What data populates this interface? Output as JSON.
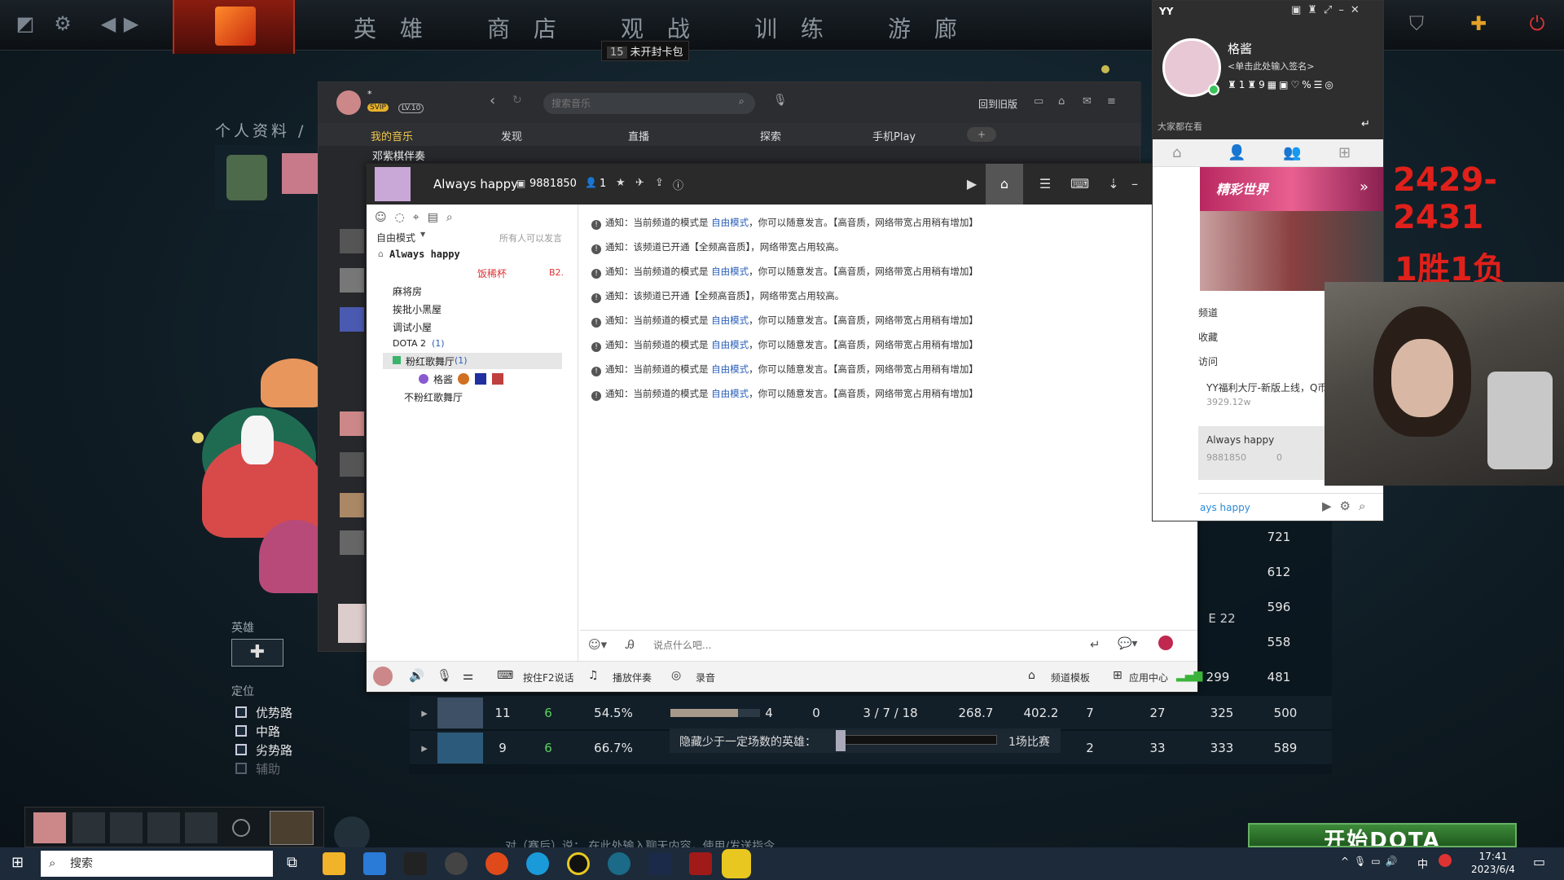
{
  "game": {
    "nav": [
      "英 雄",
      "商 店",
      "观 战",
      "训 练",
      "游 廊"
    ],
    "tooltip_num": "15",
    "tooltip_text": "未开封卡包",
    "profile_header": "个人资料  /",
    "hero_label": "英雄",
    "position_label": "定位",
    "positions": [
      "优势路",
      "中路",
      "劣势路",
      "辅助"
    ],
    "hide_label": "隐藏少于一定场数的英雄：",
    "hide_value": "1场比赛",
    "chat_hint": "对（赛后）说：  在此处输入聊天内容，使用/发送指令",
    "start_button": "开始DOTA",
    "side_badge": "E 22",
    "stats_col_right": [
      "721",
      "612",
      "596",
      "558"
    ],
    "stats_partial": {
      "c1": "299",
      "c2": "481"
    },
    "rows": [
      {
        "a": "11",
        "b": "6",
        "c": "54.5%",
        "d": "4",
        "e": "0",
        "f": "3 / 7 / 18",
        "g": "268.7",
        "h": "402.2",
        "i": "7",
        "j": "27",
        "k": "325",
        "l": "500",
        "bar": 0.75
      },
      {
        "a": "9",
        "b": "6",
        "c": "66.7%",
        "d": "",
        "e": "",
        "f": "",
        "g": "",
        "h": "",
        "i": "2",
        "j": "33",
        "k": "333",
        "l": "589",
        "bar": 0
      }
    ],
    "party_right": "收藏"
  },
  "music": {
    "user": "*",
    "badge_vip": "SVIP",
    "badge_lv": "LV.10",
    "search_placeholder": "搜索音乐",
    "back_old": "回到旧版",
    "tabs": [
      "我的音乐",
      "发现",
      "直播",
      "探索",
      "手机Play"
    ],
    "sub_title": "邓紫棋伴奏"
  },
  "channel": {
    "name": "Always happy",
    "id": "9881850",
    "users": "1",
    "mode": "自由模式",
    "mode_right": "所有人可以发言",
    "tree": [
      {
        "label": "Always happy",
        "indent": 0
      },
      {
        "label": "饭稀杯",
        "indent": 1,
        "extra": "B2."
      },
      {
        "label": "麻将房",
        "indent": 0
      },
      {
        "label": "挨批小黑屋",
        "indent": 0
      },
      {
        "label": "调试小屋",
        "indent": 0
      },
      {
        "label": "DOTA 2",
        "indent": 0,
        "count": "(1)"
      },
      {
        "label": "粉红歌舞厅",
        "indent": 1,
        "count": "(1)"
      },
      {
        "label": "格酱",
        "indent": 2
      },
      {
        "label": "不粉红歌舞厅",
        "indent": 1
      }
    ],
    "messages": [
      {
        "a": "通知：当前频道的模式是 ",
        "b": "自由模式",
        "c": "，你可以随意发言。【高音质，网络带宽占用稍有增加】"
      },
      {
        "a": "通知：该频道已开通【全频高音质】，网络带宽占用较高。",
        "b": "",
        "c": ""
      },
      {
        "a": "通知：当前频道的模式是 ",
        "b": "自由模式",
        "c": "，你可以随意发言。【高音质，网络带宽占用稍有增加】"
      },
      {
        "a": "通知：该频道已开通【全频高音质】，网络带宽占用较高。",
        "b": "",
        "c": ""
      },
      {
        "a": "通知：当前频道的模式是 ",
        "b": "自由模式",
        "c": "，你可以随意发言。【高音质，网络带宽占用稍有增加】"
      },
      {
        "a": "通知：当前频道的模式是 ",
        "b": "自由模式",
        "c": "，你可以随意发言。【高音质，网络带宽占用稍有增加】"
      },
      {
        "a": "通知：当前频道的模式是 ",
        "b": "自由模式",
        "c": "，你可以随意发言。【高音质，网络带宽占用稍有增加】"
      },
      {
        "a": "通知：当前频道的模式是 ",
        "b": "自由模式",
        "c": "，你可以随意发言。【高音质，网络带宽占用稍有增加】"
      }
    ],
    "input_placeholder": "说点什么吧...",
    "bottom": {
      "f2": "按住F2说话",
      "music": "播放伴奏",
      "record": "录音",
      "template": "频道模板",
      "apps": "应用中心"
    }
  },
  "yy": {
    "app": "YY",
    "nickname": "格酱",
    "signature": "<单击此处输入签名>",
    "watching": "大家都在看",
    "list": [
      "频道",
      "收藏",
      "访问"
    ],
    "promo": "YY福利大厅-新版上线，Q币",
    "promo_count": "3929.12w",
    "recent_name": "Always happy",
    "recent_id": "9881850",
    "recent_users": "0",
    "bottom_name": "ays happy",
    "overlay_score": "2429-2431",
    "overlay_result": "1胜1负",
    "banner": "精彩世界"
  },
  "taskbar": {
    "search": "搜索",
    "time": "17:41",
    "date": "2023/6/4",
    "ime": "中"
  }
}
